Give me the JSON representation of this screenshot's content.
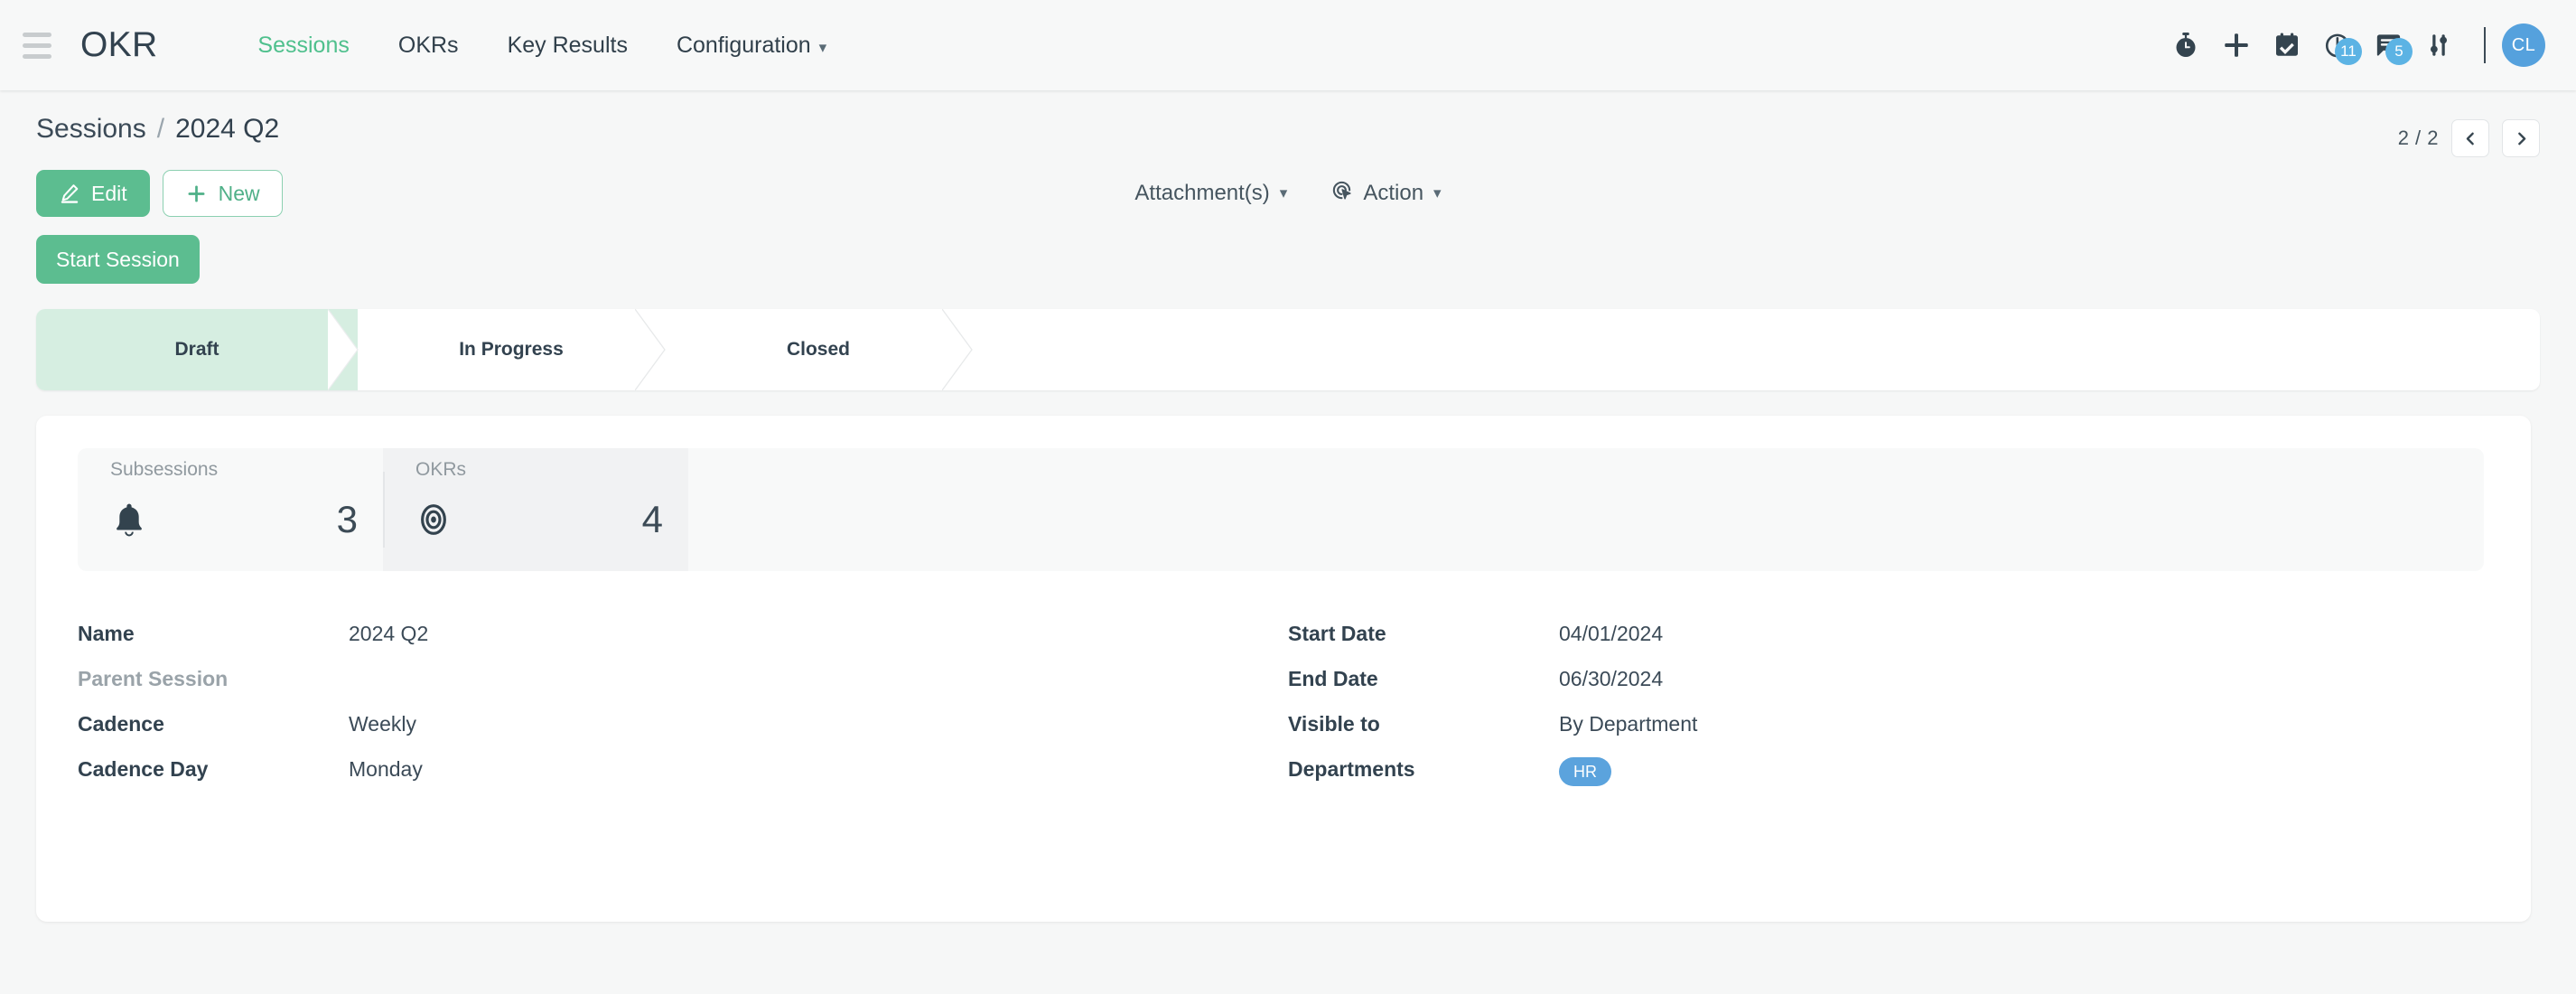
{
  "navbar": {
    "menu_icon": "hamburger-icon",
    "brand": "OKR",
    "menu": [
      {
        "label": "Sessions",
        "active": true,
        "caret": ""
      },
      {
        "label": "OKRs",
        "active": false,
        "caret": ""
      },
      {
        "label": "Key Results",
        "active": false,
        "caret": ""
      },
      {
        "label": "Configuration",
        "active": false,
        "caret": "⌄"
      }
    ],
    "icons": [
      {
        "name": "stopwatch-icon",
        "badge": ""
      },
      {
        "name": "plus-icon",
        "badge": ""
      },
      {
        "name": "calendar-check-icon",
        "badge": ""
      },
      {
        "name": "clock-icon",
        "badge": "11"
      },
      {
        "name": "messages-icon",
        "badge": "5"
      },
      {
        "name": "sliders-icon",
        "badge": ""
      }
    ],
    "avatar_initials": "CL"
  },
  "breadcrumb": {
    "parent": "Sessions",
    "separator": "/",
    "current": "2024 Q2"
  },
  "pager": {
    "count": "2 / 2",
    "prev": "‹",
    "next": "›"
  },
  "actions": {
    "edit_label": "Edit",
    "new_label": "New",
    "attachments_label": "Attachment(s)",
    "attachments_caret": "⌄",
    "action_label": "Action",
    "action_caret": "⌄",
    "start_session_label": "Start Session"
  },
  "statusbar": {
    "stages": [
      {
        "label": "Draft",
        "active": true
      },
      {
        "label": "In Progress",
        "active": false
      },
      {
        "label": "Closed",
        "active": false
      }
    ]
  },
  "stats": [
    {
      "label": "Subsessions",
      "icon": "bell-icon",
      "value": "3",
      "highlighted": false
    },
    {
      "label": "OKRs",
      "icon": "target-icon",
      "value": "4",
      "highlighted": true
    }
  ],
  "fields_left": [
    {
      "label": "Name",
      "value": "2024 Q2",
      "muted": false
    },
    {
      "label": "Parent Session",
      "value": "",
      "muted": true
    },
    {
      "label": "Cadence",
      "value": "Weekly",
      "muted": false
    },
    {
      "label": "Cadence Day",
      "value": "Monday",
      "muted": false
    }
  ],
  "fields_right": [
    {
      "label": "Start Date",
      "value": "04/01/2024",
      "muted": false,
      "pill": false
    },
    {
      "label": "End Date",
      "value": "06/30/2024",
      "muted": false,
      "pill": false
    },
    {
      "label": "Visible to",
      "value": "By Department",
      "muted": false,
      "pill": false
    },
    {
      "label": "Departments",
      "value": "HR",
      "muted": false,
      "pill": true
    }
  ],
  "colors": {
    "brand_green": "#5cbd90",
    "active_nav": "#4fc08d",
    "stage_active_bg": "#d6eee1",
    "badge_blue": "#5cb3e4",
    "avatar_blue": "#55a1dd",
    "pill_blue": "#5ba3dd",
    "text_dark": "#32424f",
    "page_bg": "#f6f7f7"
  }
}
